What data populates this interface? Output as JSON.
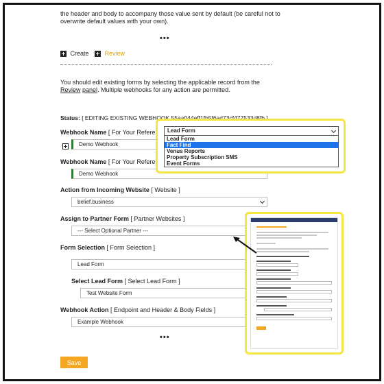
{
  "intro": {
    "line1": "the header and body to accompany those value sent by default (be careful not to",
    "line2": "overwrite default values with your own)."
  },
  "separator": "•••",
  "actions": {
    "create": "Create",
    "review": "Review"
  },
  "info": {
    "text_before": "You should edit existing forms by selecting the applicable record from the ",
    "link1": "Review",
    "link2": "panel",
    "text_after": ". Multiple webhooks for any action are permitted."
  },
  "status": {
    "label": "Status:",
    "value": "[ EDITING EXISTING WEBHOOK 55aa044eff1fb5f6ad73cf477533d8fb ]"
  },
  "fields": {
    "webhook_name_1": {
      "label": "Webhook Name",
      "sub": "[ For Your Reference Only ]",
      "value": "Demo Webhook"
    },
    "webhook_name_2": {
      "label": "Webhook Name",
      "sub": "[ For Your Reference Only ]",
      "value": "Demo Webhook"
    },
    "action_incoming": {
      "label": "Action from Incoming Website",
      "sub": "[ Website ]",
      "value": "belief.business"
    },
    "partner_form": {
      "label": "Assign to Partner Form",
      "sub": "[ Partner Websites ]",
      "value": "--- Select Optional Partner ---"
    },
    "form_selection": {
      "label": "Form Selection",
      "sub": "[ Form Selection ]",
      "value": "Lead Form"
    },
    "select_lead_form": {
      "label": "Select Lead Form",
      "sub": "[ Select Lead Form ]",
      "value": "Test Website Form"
    },
    "webhook_action": {
      "label": "Webhook Action",
      "sub": "[ Endpoint and Header & Body Fields ]",
      "value": "Example Webhook"
    }
  },
  "save_label": "Save",
  "dropdown_popup": {
    "selected": "Lead Form",
    "options": [
      "Lead Form",
      "Fact Find",
      "Venus Reports",
      "Property Subscription SMS",
      "Event Forms"
    ],
    "active_index": 1
  },
  "colors": {
    "highlight": "#f4e542",
    "accent": "#f5a623",
    "selection": "#1e73e8",
    "field_border": "#2e7d32"
  }
}
